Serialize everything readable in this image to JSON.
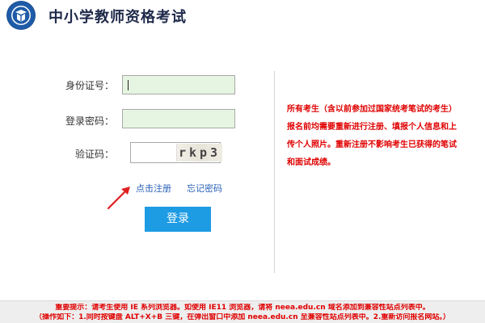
{
  "header": {
    "title": "中小学教师资格考试",
    "logo_icon": "university-logo-icon",
    "logo_color": "#1e5ba8"
  },
  "form": {
    "id_label": "身份证号：",
    "id_value": "",
    "password_label": "登录密码：",
    "password_value": "",
    "captcha_label": "验证码：",
    "captcha_value": "",
    "captcha_text": "rkp3",
    "input_bg_color": "#e6f5e1"
  },
  "links": {
    "register": "点击注册",
    "forgot_password": "忘记密码"
  },
  "login_button": {
    "label": "登录",
    "color": "#1d9be3"
  },
  "annotation": {
    "arrow_icon": "red-arrow-icon",
    "color": "#e02020"
  },
  "notice": {
    "text": "所有考生（含以前参加过国家统考笔试的考生）报名前均需要重新进行注册、填报个人信息和上传个人照片。重新注册不影响考生已获得的笔试和面试成绩。",
    "color": "#e00000"
  },
  "footer": {
    "line1": "重要提示：请考生使用 IE 系列浏览器。如使用 IE11 浏览器，请将 neea.edu.cn 域名添加到兼容性站点列表中。",
    "line2": "（操作如下：1.同时按键盘 ALT+X+B 三键，在弹出窗口中添加 neea.edu.cn 至兼容性站点列表中。2.重新访问报名网站。）"
  }
}
